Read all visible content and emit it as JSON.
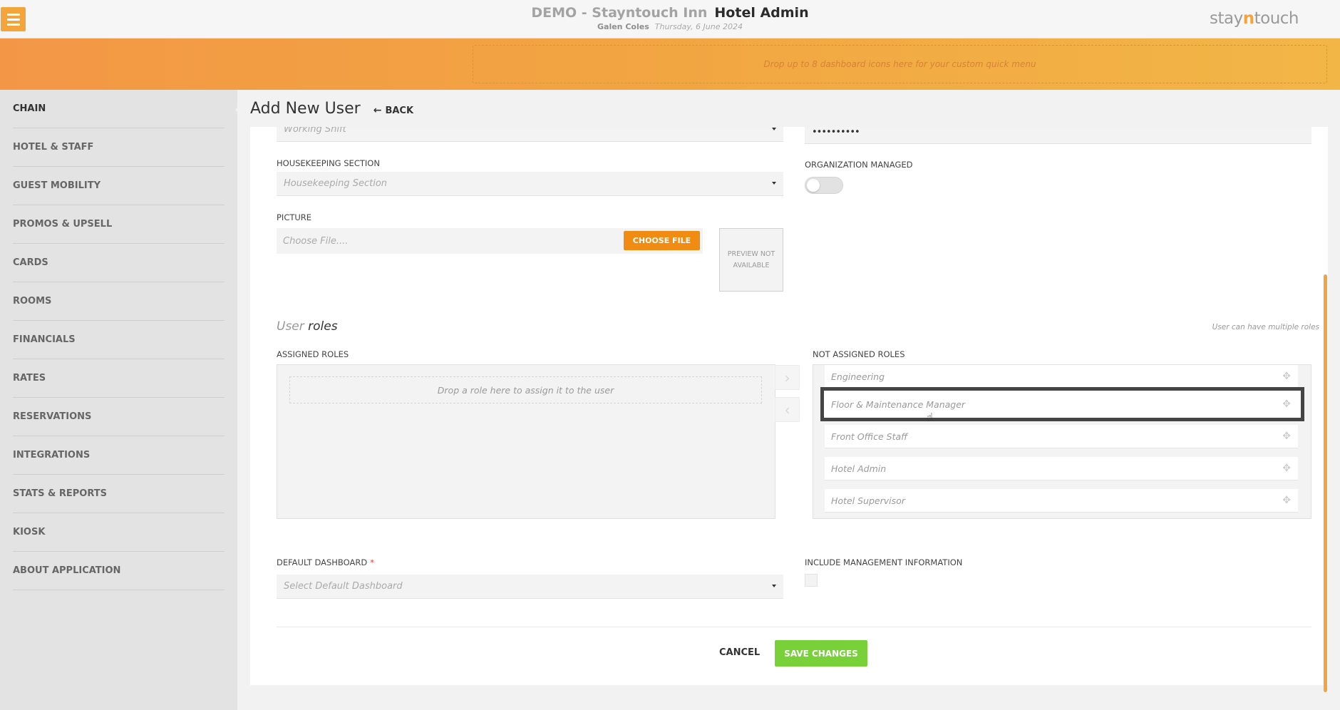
{
  "header": {
    "property_name": "DEMO - Stayntouch Inn",
    "app_title": "Hotel Admin",
    "user_name": "Galen Coles",
    "date": "Thursday, 6 June 2024",
    "brand_pre": "stay",
    "brand_n": "n",
    "brand_post": "touch"
  },
  "quickmenu": {
    "hint": "Drop up to 8 dashboard icons here for your custom quick menu"
  },
  "sidebar": {
    "items": [
      {
        "label": "CHAIN"
      },
      {
        "label": "HOTEL & STAFF"
      },
      {
        "label": "GUEST MOBILITY"
      },
      {
        "label": "PROMOS & UPSELL"
      },
      {
        "label": "CARDS"
      },
      {
        "label": "ROOMS"
      },
      {
        "label": "FINANCIALS"
      },
      {
        "label": "RATES"
      },
      {
        "label": "RESERVATIONS"
      },
      {
        "label": "INTEGRATIONS"
      },
      {
        "label": "STATS & REPORTS"
      },
      {
        "label": "KIOSK"
      },
      {
        "label": "ABOUT APPLICATION"
      }
    ]
  },
  "page": {
    "title": "Add New User",
    "back_label": "BACK",
    "back_arrow": "←"
  },
  "form": {
    "working_shift": {
      "value": "Working Shift"
    },
    "password": {
      "value": "••••••••••"
    },
    "housekeeping": {
      "label": "HOUSEKEEPING SECTION",
      "value": "Housekeeping Section"
    },
    "org_managed": {
      "label": "ORGANIZATION MANAGED",
      "on": false
    },
    "picture": {
      "label": "PICTURE",
      "placeholder": "Choose File....",
      "button": "CHOOSE FILE",
      "preview": "PREVIEW NOT AVAILABLE"
    },
    "roles": {
      "title_prefix": "User",
      "title_main": "roles",
      "hint": "User can have multiple roles",
      "assigned_label": "ASSIGNED ROLES",
      "assigned_drop": "Drop a role here to assign it to the user",
      "not_assigned_label": "NOT ASSIGNED ROLES",
      "not_assigned": [
        {
          "label": "Engineering"
        },
        {
          "label": "Floor & Maintenance Manager"
        },
        {
          "label": "Front Office Staff"
        },
        {
          "label": "Hotel Admin"
        },
        {
          "label": "Hotel Supervisor"
        }
      ],
      "move_right": "›",
      "move_left": "‹"
    },
    "default_dashboard": {
      "label": "DEFAULT DASHBOARD",
      "required": "*",
      "value": "Select Default Dashboard"
    },
    "include_mgmt": {
      "label": "INCLUDE MANAGEMENT INFORMATION",
      "checked": false
    }
  },
  "actions": {
    "cancel": "CANCEL",
    "save": "SAVE CHANGES"
  },
  "colors": {
    "accent": "#f3a43a",
    "save": "#79d13a",
    "choose_file": "#f08c12"
  },
  "icons": {
    "drag": "✥",
    "cursor": "☝"
  }
}
